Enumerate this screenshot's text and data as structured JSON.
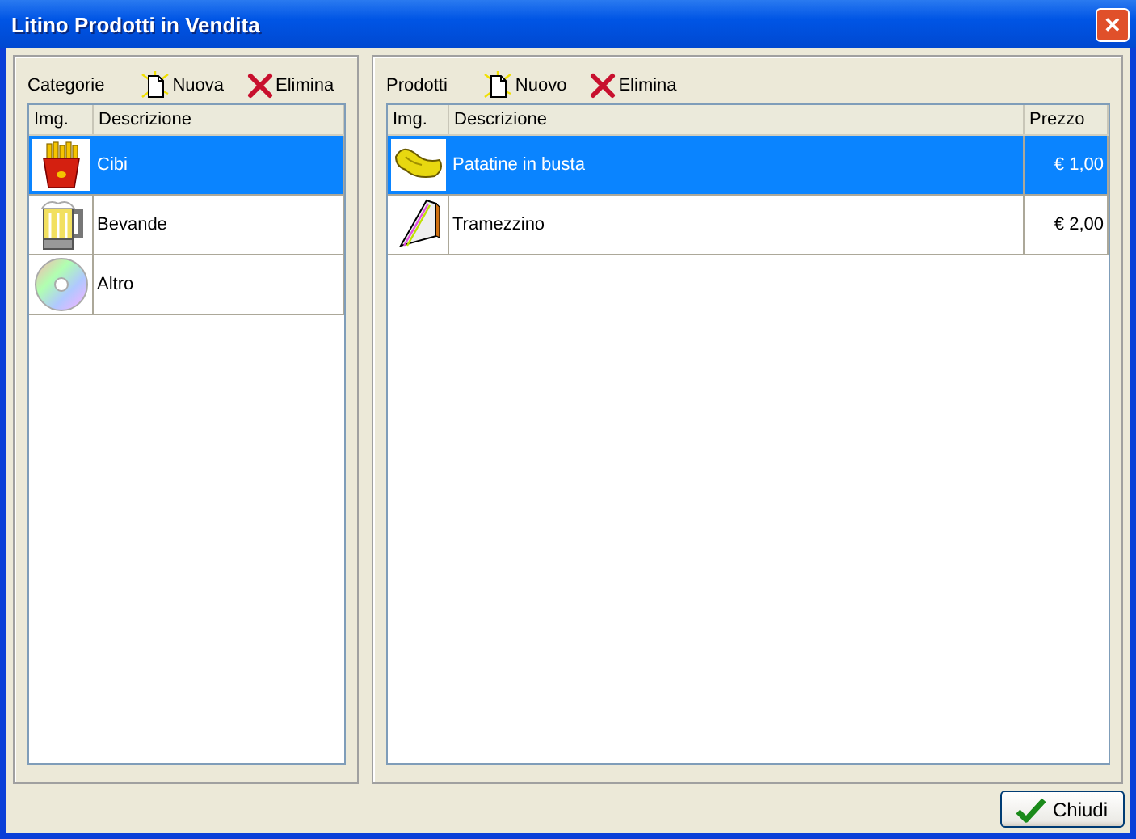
{
  "window": {
    "title": "Litino Prodotti in Vendita",
    "close": "✕"
  },
  "categories": {
    "label": "Categorie",
    "add": "Nuova",
    "delete": "Elimina",
    "columns": [
      "Img.",
      "Descrizione"
    ],
    "rows": [
      {
        "kind": "fries",
        "description": "Cibi",
        "selected": true
      },
      {
        "kind": "mug",
        "description": "Bevande",
        "selected": false
      },
      {
        "kind": "disc",
        "description": "Altro",
        "selected": false
      }
    ]
  },
  "products": {
    "label": "Prodotti",
    "add": "Nuovo",
    "delete": "Elimina",
    "columns": [
      "Img.",
      "Descrizione",
      "Prezzo"
    ],
    "rows": [
      {
        "kind": "chips",
        "description": "Patatine in busta",
        "price": "€ 1,00",
        "selected": true
      },
      {
        "kind": "sandwich",
        "description": "Tramezzino",
        "price": "€ 2,00",
        "selected": false
      }
    ]
  },
  "buttons": [
    {
      "label": "Chiudi"
    }
  ]
}
